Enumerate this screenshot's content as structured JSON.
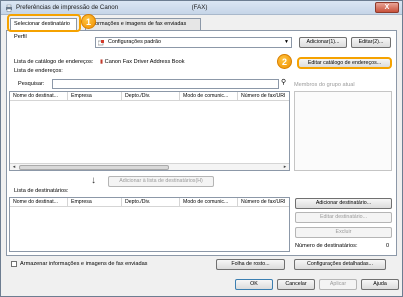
{
  "window": {
    "title_left": "Preferências de impressão de Canon",
    "title_right": "(FAX)",
    "close_label": "X"
  },
  "tabs": [
    {
      "label": "Selecionar destinatário",
      "active": true
    },
    {
      "label": "Informações e imagens de fax enviadas",
      "active": false
    }
  ],
  "badges": [
    "1",
    "2"
  ],
  "profile": {
    "label": "Perfil",
    "value": "Configurações padrão",
    "add_label": "Adicionar(1)...",
    "edit_label": "Editar(2)..."
  },
  "address_book": {
    "list_label": "Lista de catálogo de endereços:",
    "list_value": "Canon Fax Driver Address Book",
    "edit_button": "Editar catálogo de endereços...",
    "list_title": "Lista de endereços:",
    "search_label": "Pesquisar:",
    "group_label": "Membros do grupo atual",
    "columns": [
      "Nome do destinat...",
      "Empresa",
      "Depto./Div.",
      "Modo de comunic...",
      "Número de fax/URI"
    ]
  },
  "add_to_list": {
    "button": "Adicionar à lista de destinatários(H)"
  },
  "recipients": {
    "list_title": "Lista de destinatários:",
    "columns": [
      "Nome do destinat...",
      "Empresa",
      "Depto./Div.",
      "Modo de comunic...",
      "Número de fax/URI"
    ],
    "add_button": "Adicionar destinatário...",
    "edit_button": "Editar destinatário...",
    "delete_button": "Excluir",
    "count_label": "Número de destinatários:",
    "count_value": "0"
  },
  "footer": {
    "store_label": "Armazenar informações e imagens de fax enviadas",
    "cover_button": "Folha de rosto...",
    "detail_button": "Configurações detalhadas...",
    "ok": "OK",
    "cancel": "Cancelar",
    "apply": "Aplicar",
    "help": "Ajuda"
  },
  "colors": {
    "highlight": "#f5a200",
    "accent_border": "#8c98a8"
  }
}
